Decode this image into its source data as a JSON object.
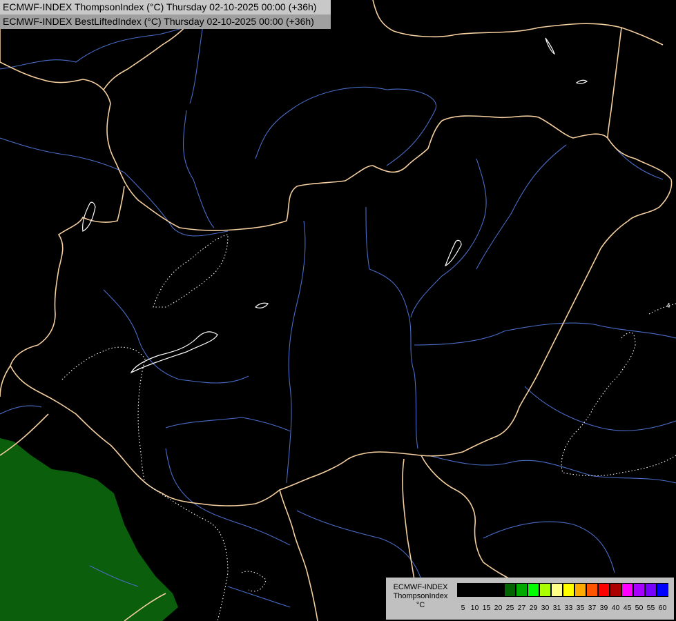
{
  "header": {
    "title_line1": "ECMWF-INDEX ThompsonIndex (°C) Thursday 02-10-2025 00:00 (+36h)",
    "title_line2": "ECMWF-INDEX BestLiftedIndex (°C) Thursday 02-10-2025 00:00 (+36h)"
  },
  "map": {
    "background_color": "#000000",
    "border_color": "#f5cf9f",
    "river_color": "#4a6cc8",
    "contour_color": "#ffffff",
    "shaded_region_color": "#0b5e0b",
    "contour_label": "4"
  },
  "legend": {
    "model": "ECMWF-INDEX",
    "param": "ThompsonIndex",
    "unit": "°C",
    "ticks": [
      "5",
      "10",
      "15",
      "20",
      "25",
      "27",
      "29",
      "30",
      "31",
      "33",
      "35",
      "37",
      "39",
      "40",
      "45",
      "50",
      "55",
      "60"
    ],
    "colors": [
      "#000000",
      "#000000",
      "#000000",
      "#000000",
      "#006400",
      "#00aa00",
      "#00ff00",
      "#aaff00",
      "#ffff88",
      "#ffff00",
      "#ffaa00",
      "#ff5500",
      "#ff0000",
      "#aa0000",
      "#ff00ff",
      "#aa00ff",
      "#7700ff",
      "#0000ff"
    ]
  }
}
